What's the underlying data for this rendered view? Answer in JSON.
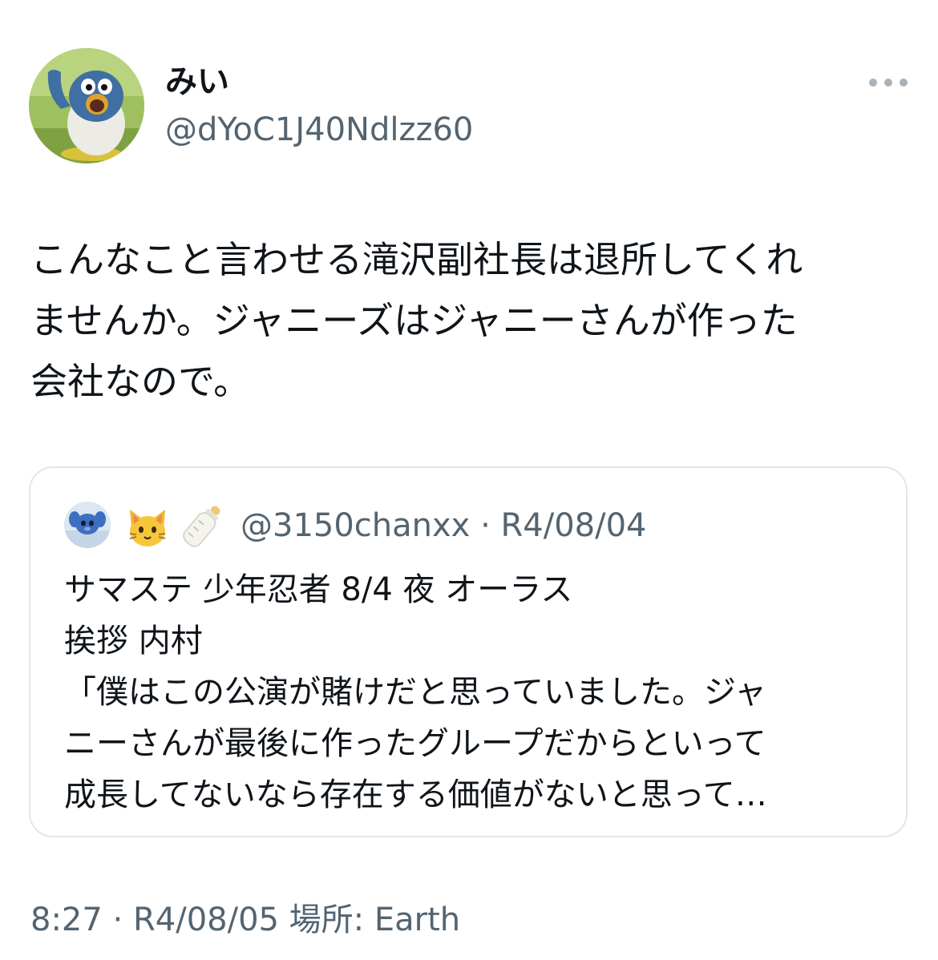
{
  "tweet": {
    "author": {
      "display_name": "みい",
      "handle": "@dYoC1J40Ndlzz60",
      "avatar_icon": "penguin-avatar-icon"
    },
    "text_lines": [
      "こんなこと言わせる滝沢副社長は退所してくれ",
      "ませんか。ジャニーズはジャニーさんが作った",
      "会社なので。"
    ],
    "timestamp": "8:27 · R4/08/05 場所: Earth"
  },
  "quote": {
    "handle": "@3150chanxx",
    "date": "R4/08/04",
    "meta_line": "@3150chanxx · R4/08/04",
    "text_lines": [
      "サマステ 少年忍者 8/4 夜 オーラス",
      "挨拶 内村",
      "「僕はこの公演が賭けだと思っていました。ジャ",
      "ニーさんが最後に作ったグループだからといって",
      "成長してないなら存在する価値がないと思って…"
    ]
  },
  "colors": {
    "text_primary": "#0f1419",
    "text_secondary": "#536471",
    "card_border": "#e1e6ea"
  }
}
